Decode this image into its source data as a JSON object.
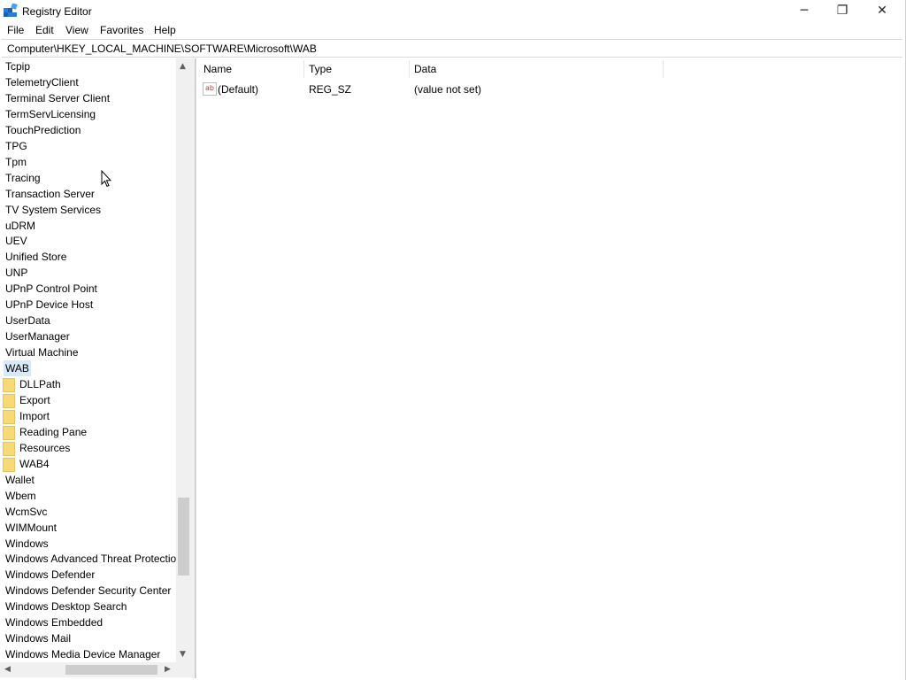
{
  "window": {
    "title": "Registry Editor",
    "minimize_glyph": "─",
    "restore_glyph": "❐",
    "close_glyph": "✕",
    "icon": "registry-editor-icon"
  },
  "menu": {
    "file": "File",
    "edit": "Edit",
    "view": "View",
    "favorites": "Favorites",
    "help": "Help"
  },
  "address": {
    "path": "Computer\\HKEY_LOCAL_MACHINE\\SOFTWARE\\Microsoft\\WAB"
  },
  "tree": {
    "items": [
      {
        "label": "Tcpip"
      },
      {
        "label": "TelemetryClient"
      },
      {
        "label": "Terminal Server Client"
      },
      {
        "label": "TermServLicensing"
      },
      {
        "label": "TouchPrediction"
      },
      {
        "label": "TPG"
      },
      {
        "label": "Tpm"
      },
      {
        "label": "Tracing"
      },
      {
        "label": "Transaction Server"
      },
      {
        "label": "TV System Services"
      },
      {
        "label": "uDRM"
      },
      {
        "label": "UEV"
      },
      {
        "label": "Unified Store"
      },
      {
        "label": "UNP"
      },
      {
        "label": "UPnP Control Point"
      },
      {
        "label": "UPnP Device Host"
      },
      {
        "label": "UserData"
      },
      {
        "label": "UserManager"
      },
      {
        "label": "Virtual Machine"
      },
      {
        "label": "WAB"
      },
      {
        "label": "DLLPath"
      },
      {
        "label": "Export"
      },
      {
        "label": "Import"
      },
      {
        "label": "Reading Pane"
      },
      {
        "label": "Resources"
      },
      {
        "label": "WAB4"
      },
      {
        "label": "Wallet"
      },
      {
        "label": "Wbem"
      },
      {
        "label": "WcmSvc"
      },
      {
        "label": "WIMMount"
      },
      {
        "label": "Windows"
      },
      {
        "label": "Windows Advanced Threat Protection"
      },
      {
        "label": "Windows Defender"
      },
      {
        "label": "Windows Defender Security Center"
      },
      {
        "label": "Windows Desktop Search"
      },
      {
        "label": "Windows Embedded"
      },
      {
        "label": "Windows Mail"
      },
      {
        "label": "Windows Media Device Manager"
      }
    ],
    "scroll_up": "▲",
    "scroll_down": "▼",
    "scroll_left": "◀",
    "scroll_right": "▶"
  },
  "list": {
    "columns": {
      "name": "Name",
      "type": "Type",
      "data": "Data"
    },
    "rows": [
      {
        "icon": "ab",
        "name": "(Default)",
        "type": "REG_SZ",
        "data": "(value not set)"
      }
    ]
  },
  "colors": {
    "selection": "#d9e8f8",
    "folder": "#f7d978"
  }
}
